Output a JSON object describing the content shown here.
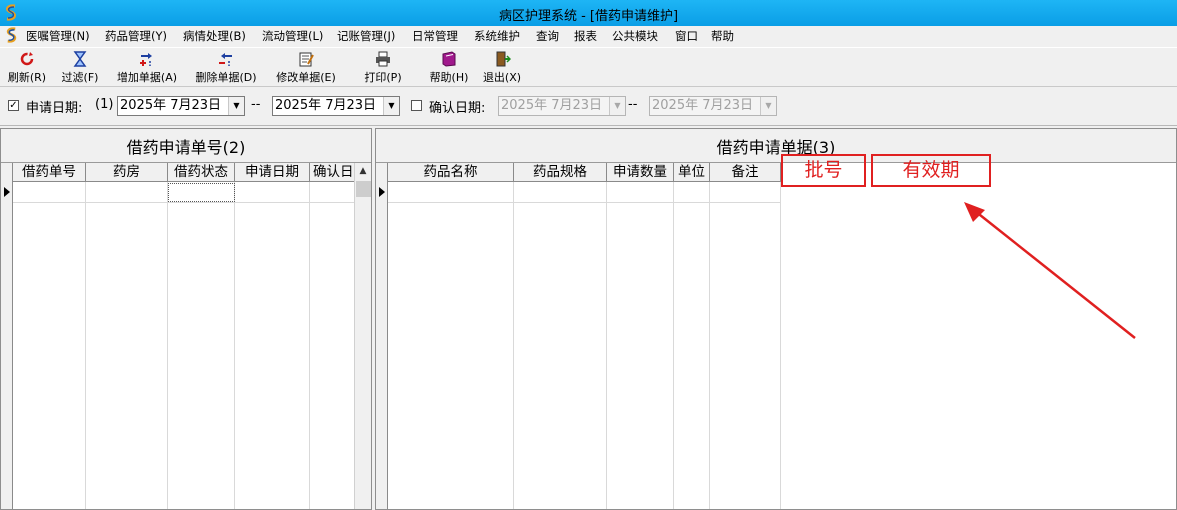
{
  "window": {
    "title": "病区护理系统 - [借药申请维护]"
  },
  "menu": {
    "items": [
      {
        "label": "医嘱管理(N)"
      },
      {
        "label": "药品管理(Y)"
      },
      {
        "label": "病情处理(B)"
      },
      {
        "label": "流动管理(L)"
      },
      {
        "label": "记账管理(J)"
      },
      {
        "label": "日常管理"
      },
      {
        "label": "系统维护"
      },
      {
        "label": "查询"
      },
      {
        "label": "报表"
      },
      {
        "label": "公共模块"
      },
      {
        "label": "窗口"
      },
      {
        "label": "帮助"
      }
    ]
  },
  "toolbar": {
    "refresh": "刷新(R)",
    "filter": "过滤(F)",
    "add": "增加单据(A)",
    "delete": "删除单据(D)",
    "edit": "修改单据(E)",
    "print": "打印(P)",
    "help": "帮助(H)",
    "exit": "退出(X)"
  },
  "filter": {
    "apply_date_checked": true,
    "apply_date_label": "申请日期:",
    "marker1": "(1)",
    "apply_from": "2025年  7月23日",
    "separator1": "--",
    "apply_to": "2025年  7月23日",
    "confirm_date_checked": false,
    "confirm_date_label": "确认日期:",
    "confirm_from": "2025年  7月23日",
    "separator2": "--",
    "confirm_to": "2025年  7月23日"
  },
  "left_panel": {
    "title": "借药申请单号",
    "marker": "(2)",
    "columns": [
      "借药单号",
      "药房",
      "借药状态",
      "申请日期",
      "确认日"
    ]
  },
  "right_panel": {
    "title": "借药申请单据",
    "marker": "(3)",
    "columns": [
      "药品名称",
      "药品规格",
      "申请数量",
      "单位",
      "备注"
    ]
  },
  "annotations": {
    "batch_number": "批号",
    "expiry_date": "有效期",
    "color": "#e02020"
  },
  "icons": {
    "app": "app-logo-icon",
    "refresh": "refresh-icon",
    "filter": "hourglass-filter-icon",
    "add": "add-record-icon",
    "delete": "delete-record-icon",
    "edit": "edit-record-icon",
    "print": "printer-icon",
    "help": "help-book-icon",
    "exit": "exit-door-icon"
  }
}
